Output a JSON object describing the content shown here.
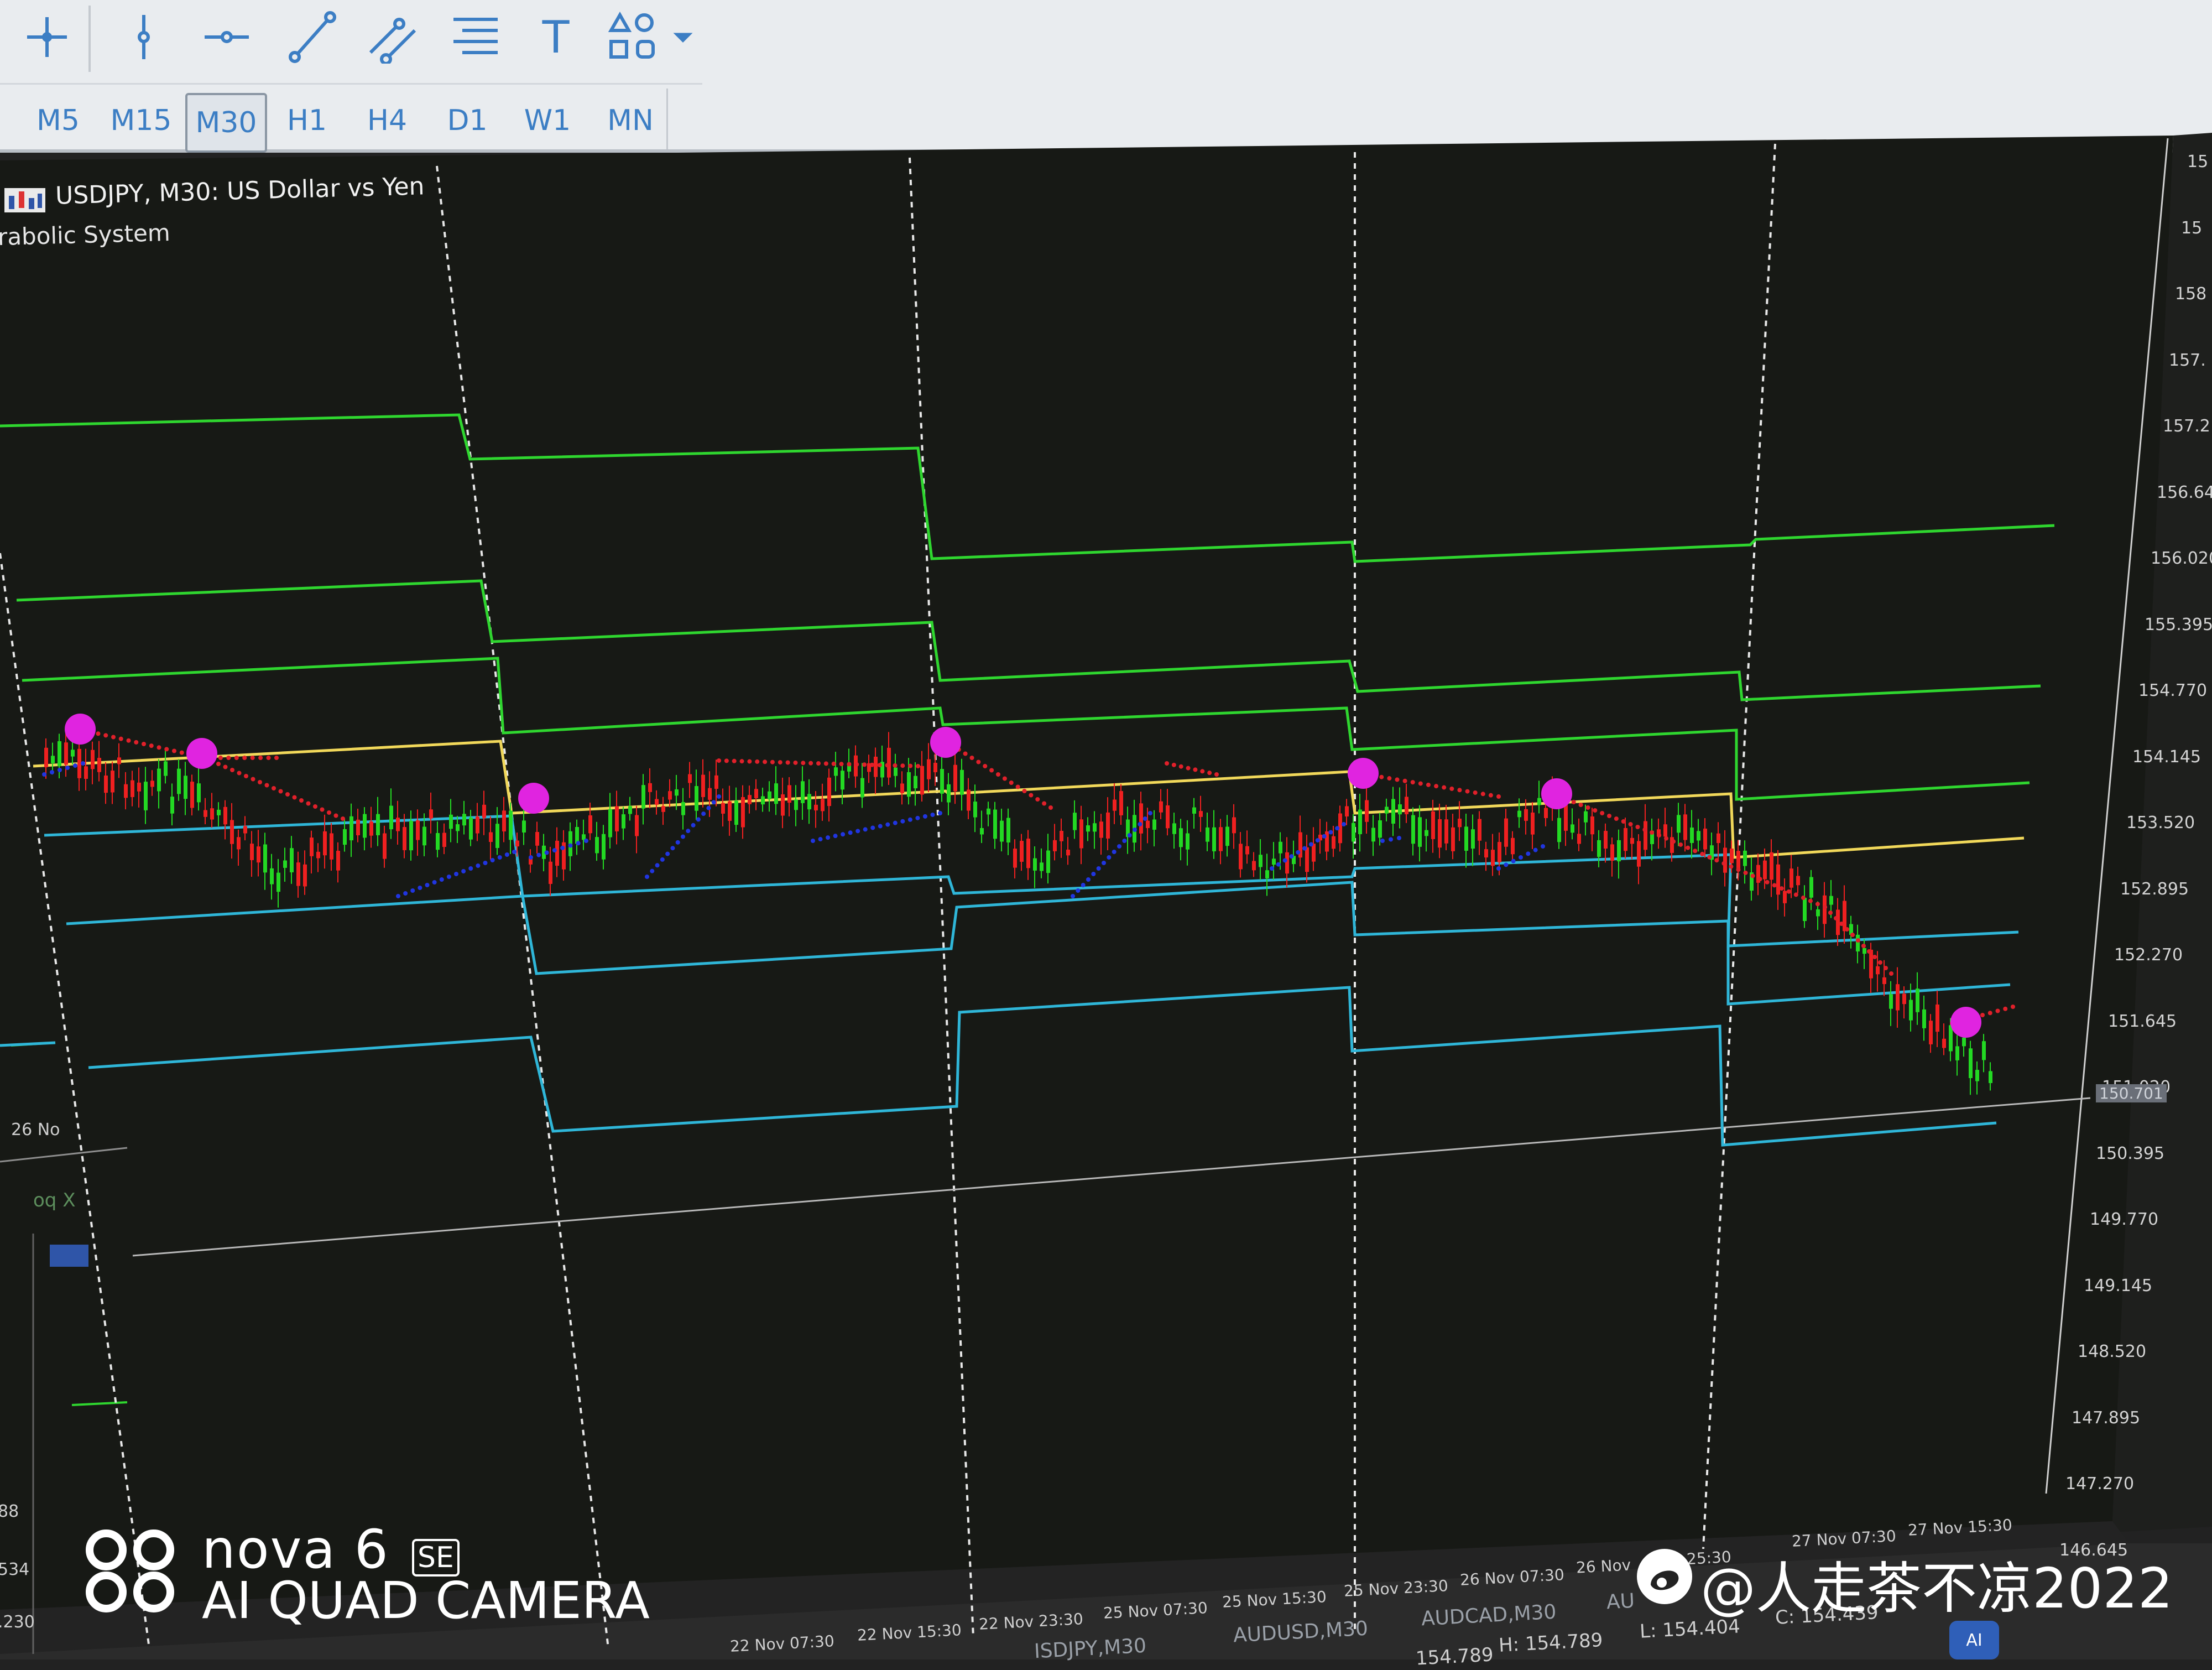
{
  "toolbar": {
    "tools": [
      {
        "icon": "crosshair-icon"
      },
      {
        "icon": "vertical-line-icon"
      },
      {
        "icon": "horizontal-line-icon"
      },
      {
        "icon": "trendline-icon"
      },
      {
        "icon": "channel-icon"
      },
      {
        "icon": "fibonacci-icon"
      },
      {
        "icon": "text-icon",
        "glyph": "T"
      },
      {
        "icon": "shapes-icon"
      },
      {
        "icon": "chevron-down-icon"
      }
    ],
    "timeframes": [
      "M5",
      "M15",
      "M30",
      "H1",
      "H4",
      "D1",
      "W1",
      "MN"
    ],
    "active_timeframe": "M30"
  },
  "chart": {
    "title": "USDJPY, M30:  US Dollar vs Yen",
    "indicator": "rabolic System",
    "colors": {
      "background": "#171915",
      "bull_candle": "#23d923",
      "bear_candle": "#ef2020",
      "parabolic_sar_above": "#e0202a",
      "parabolic_sar_below": "#2035e0",
      "pivot": "#f1d85a",
      "resistance": "#2fd62f",
      "support": "#2fb6d8",
      "sar_reversal_marker": "#e024e0"
    },
    "price_axis": [
      "15",
      "15",
      "158",
      "157.",
      "157.2",
      "156.64",
      "156.020",
      "155.395",
      "154.770",
      "154.145",
      "153.520",
      "152.895",
      "152.270",
      "151.645",
      "151.020",
      "150.395",
      "149.770",
      "149.145",
      "148.520",
      "147.895",
      "147.270",
      "146.645"
    ],
    "current_price": "150.701",
    "time_axis": [
      "22 Nov 07:30",
      "22 Nov 15:30",
      "22 Nov 23:30",
      "25 Nov 07:30",
      "25 Nov 15:30",
      "25 Nov 23:30",
      "26 Nov 07:30",
      "26 Nov",
      "25:30",
      "27 Nov 07:30",
      "27 Nov 15:30"
    ],
    "nav_window_date": "26 No",
    "nav_window_symbol": "oq X",
    "left_partial_values": [
      "88",
      "534",
      ".230"
    ]
  },
  "bottom_tabs": [
    "ISDJPY,M30",
    "AUDUSD,M30",
    "AUDCAD,M30",
    "AU"
  ],
  "status": {
    "high": "H: 154.789",
    "low": "L: 154.404",
    "close": "C: 154.439",
    "partial": "154.789",
    "badge": "AI"
  },
  "watermark": {
    "model": "nova 6",
    "model_suffix": "SE",
    "subtitle": "AI QUAD CAMERA",
    "handle": "@人走茶不凉2022"
  }
}
